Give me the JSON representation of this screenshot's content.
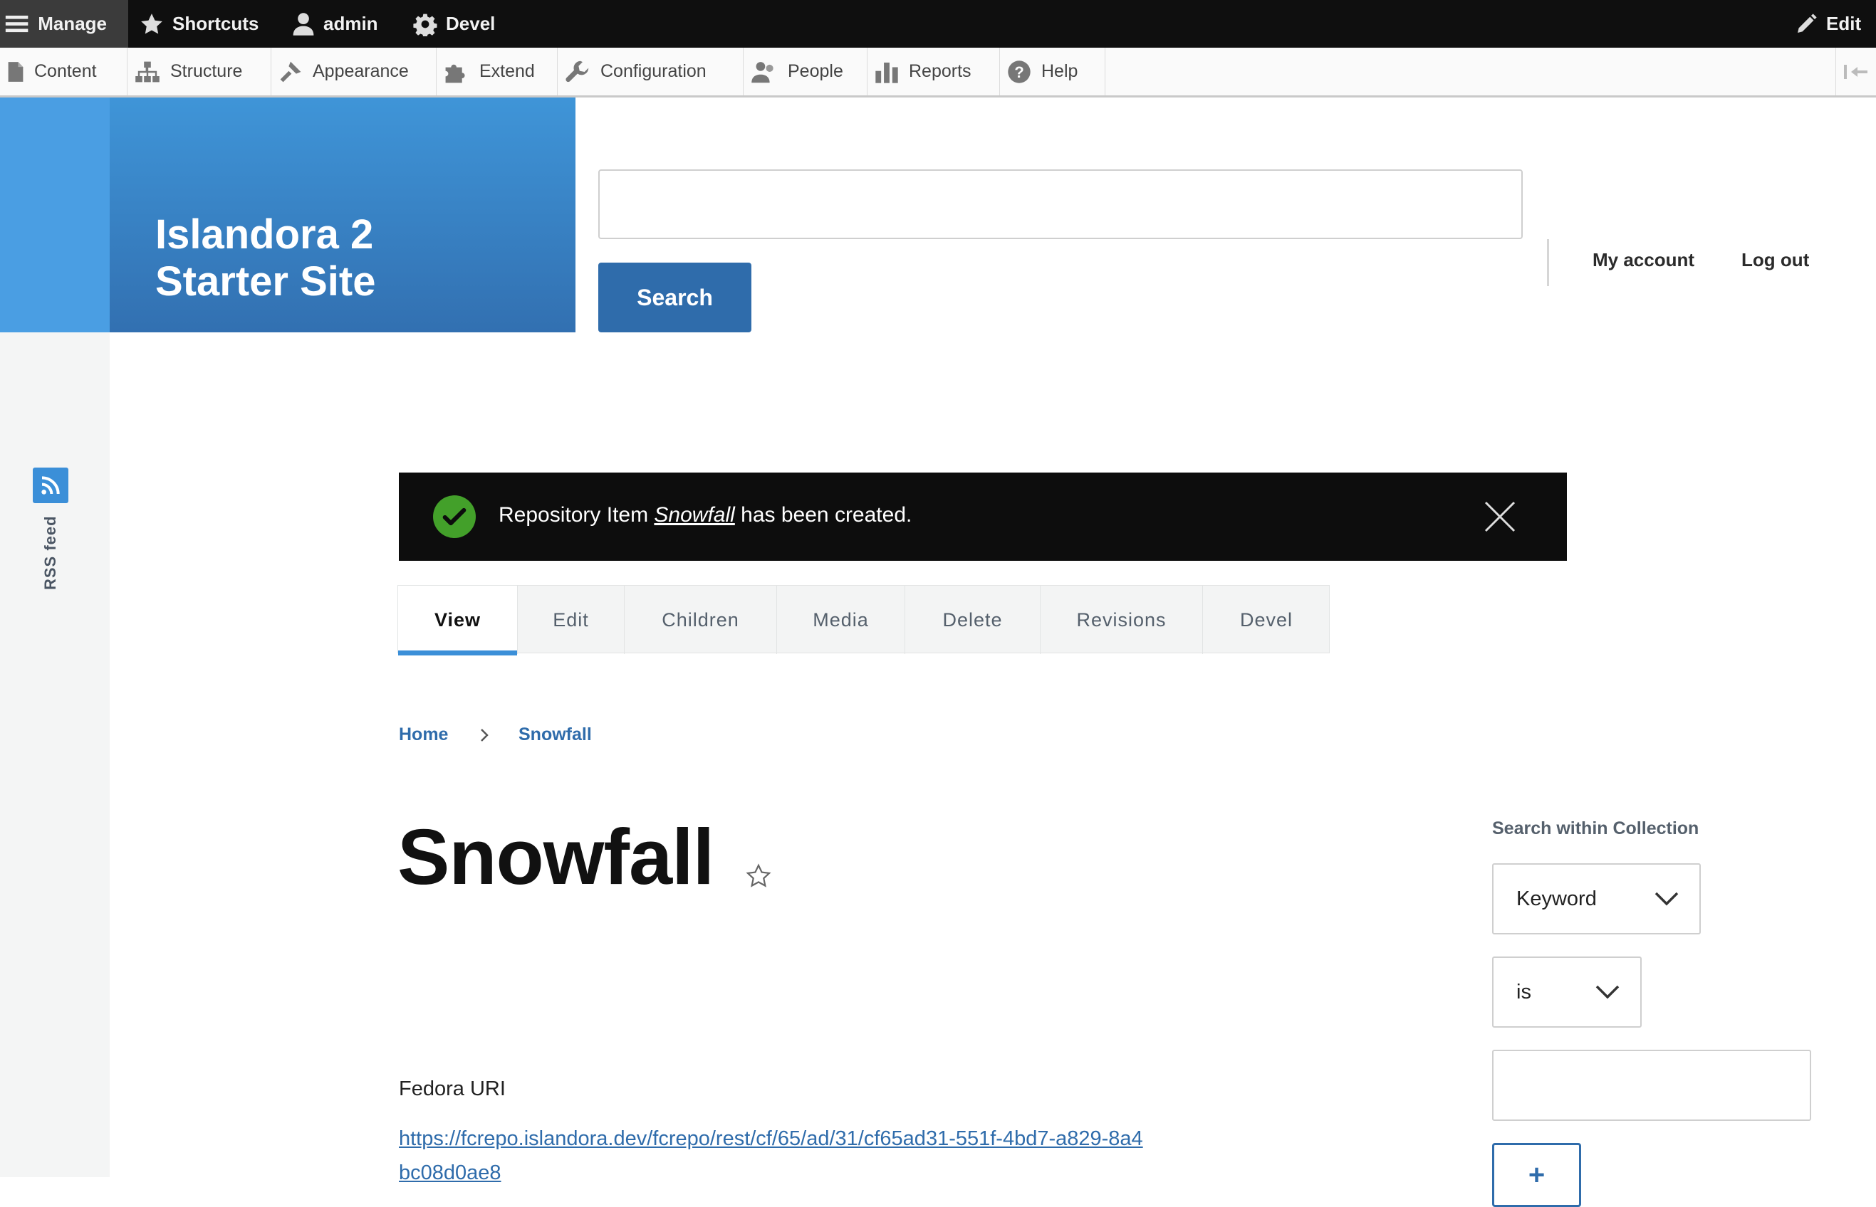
{
  "toolbar": {
    "manage": "Manage",
    "shortcuts": "Shortcuts",
    "user": "admin",
    "devel": "Devel",
    "edit": "Edit"
  },
  "tray": {
    "items": [
      {
        "label": "Content",
        "icon": "page-icon"
      },
      {
        "label": "Structure",
        "icon": "sitemap-icon"
      },
      {
        "label": "Appearance",
        "icon": "paintbrush-icon"
      },
      {
        "label": "Extend",
        "icon": "puzzle-icon"
      },
      {
        "label": "Configuration",
        "icon": "wrench-icon"
      },
      {
        "label": "People",
        "icon": "people-icon"
      },
      {
        "label": "Reports",
        "icon": "bar-chart-icon"
      },
      {
        "label": "Help",
        "icon": "help-icon"
      }
    ]
  },
  "site": {
    "name_line1": "Islandora 2",
    "name_line2": "Starter Site",
    "brand_color": "#3a82c6"
  },
  "search": {
    "value": "",
    "button": "Search"
  },
  "account": {
    "my_account": "My account",
    "logout": "Log out"
  },
  "rss": {
    "label": "RSS feed"
  },
  "message": {
    "prefix": "Repository Item ",
    "item": "Snowfall",
    "suffix": " has been created."
  },
  "local_tabs": [
    "View",
    "Edit",
    "Children",
    "Media",
    "Delete",
    "Revisions",
    "Devel"
  ],
  "breadcrumb": {
    "home": "Home",
    "current": "Snowfall"
  },
  "page": {
    "title": "Snowfall"
  },
  "field": {
    "label": "Fedora URI",
    "value": "https://fcrepo.islandora.dev/fcrepo/rest/cf/65/ad/31/cf65ad31-551f-4bd7-a829-8a4bc08d0ae8"
  },
  "sidebar": {
    "title": "Search within Collection",
    "field_select": "Keyword",
    "operator_select": "is",
    "value": "",
    "add_button": "+"
  },
  "colors": {
    "accent": "#2f6cab",
    "success": "#43a02a",
    "tab_active": "#3b8fd8"
  }
}
